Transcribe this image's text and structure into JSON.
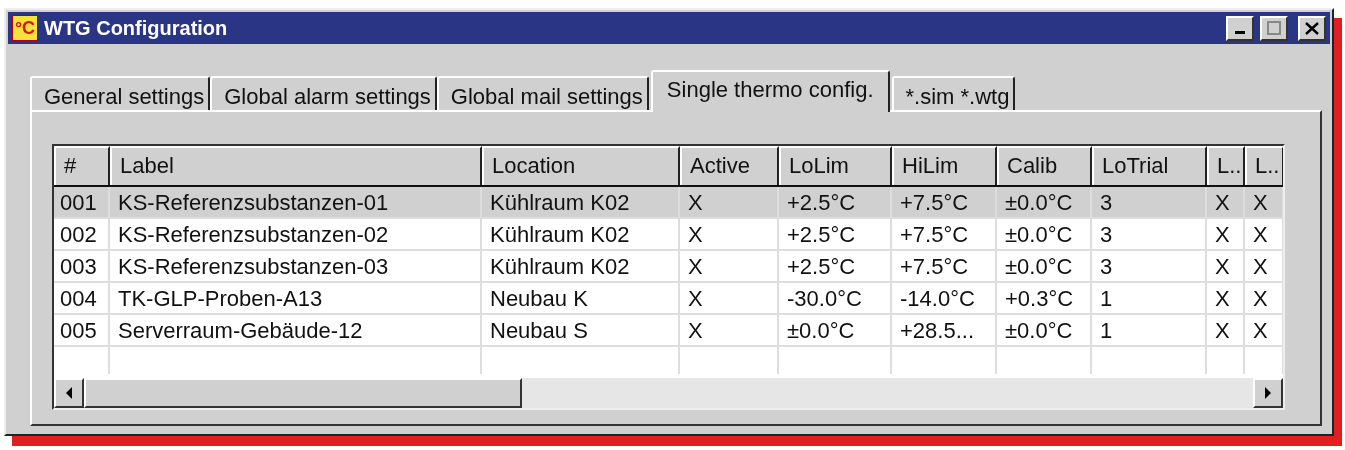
{
  "window": {
    "title": "WTG Configuration",
    "icon_text": "°C"
  },
  "tabs": [
    {
      "label": "General settings",
      "selected": false
    },
    {
      "label": "Global alarm settings",
      "selected": false
    },
    {
      "label": "Global mail settings",
      "selected": false
    },
    {
      "label": "Single thermo config.",
      "selected": true
    },
    {
      "label": "*.sim *.wtg",
      "selected": false
    }
  ],
  "table": {
    "columns": [
      "#",
      "Label",
      "Location",
      "Active",
      "LoLim",
      "HiLim",
      "Calib",
      "LoTrial",
      "L..",
      "L.."
    ],
    "rows": [
      {
        "selected": true,
        "cells": [
          "001",
          "KS-Referenzsubstanzen-01",
          "Kühlraum K02",
          "X",
          "+2.5°C",
          "+7.5°C",
          "±0.0°C",
          "3",
          "X",
          "X"
        ]
      },
      {
        "selected": false,
        "cells": [
          "002",
          "KS-Referenzsubstanzen-02",
          "Kühlraum K02",
          "X",
          "+2.5°C",
          "+7.5°C",
          "±0.0°C",
          "3",
          "X",
          "X"
        ]
      },
      {
        "selected": false,
        "cells": [
          "003",
          "KS-Referenzsubstanzen-03",
          "Kühlraum K02",
          "X",
          "+2.5°C",
          "+7.5°C",
          "±0.0°C",
          "3",
          "X",
          "X"
        ]
      },
      {
        "selected": false,
        "cells": [
          "004",
          "TK-GLP-Proben-A13",
          "Neubau K",
          "X",
          "-30.0°C",
          "-14.0°C",
          "+0.3°C",
          "1",
          "X",
          "X"
        ]
      },
      {
        "selected": false,
        "cells": [
          "005",
          "Serverraum-Gebäude-12",
          "Neubau S",
          "X",
          "±0.0°C",
          "+28.5...",
          "±0.0°C",
          "1",
          "X",
          "X"
        ]
      }
    ]
  }
}
